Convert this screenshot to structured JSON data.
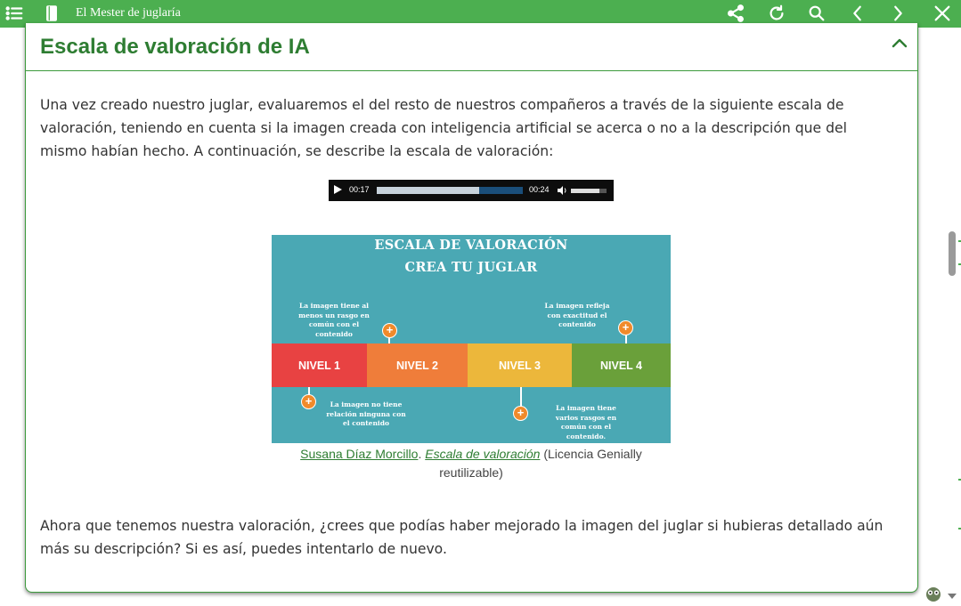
{
  "app": {
    "title": "El Mester de juglaría"
  },
  "toolbar": {
    "icons": [
      "menu-icon",
      "book-icon",
      "share-icon",
      "refresh-icon",
      "search-icon",
      "chevron-left-icon",
      "chevron-right-icon",
      "close-icon"
    ]
  },
  "section": {
    "title": "Escala de valoración de IA",
    "intro": "Una vez creado nuestro juglar, evaluaremos el del resto de nuestros compañeros a través de la siguiente escala de valoración, teniendo en cuenta si la imagen creada con inteligencia artificial se acerca o no a la descripción que del mismo habían hecho.  A continuación, se describe la escala de valoración:",
    "closing": "Ahora que tenemos nuestra valoración, ¿crees que podías haber mejorado la imagen del juglar si hubieras detallado aún más su descripción? Si es así, puedes intentarlo de nuevo."
  },
  "audio": {
    "current_time": "00:17",
    "duration": "00:24",
    "progress": 0.7,
    "volume": 0.8
  },
  "infographic": {
    "title_line1": "ESCALA DE VALORACIÓN",
    "title_line2": "CREA TU JUGLAR",
    "levels": [
      {
        "label": "NIVEL 1",
        "color": "#e84242"
      },
      {
        "label": "NIVEL 2",
        "color": "#ef7d3a"
      },
      {
        "label": "NIVEL 3",
        "color": "#ecb73b"
      },
      {
        "label": "NIVEL 4",
        "color": "#6aa03a"
      }
    ],
    "notes": {
      "n1": "La imagen no tiene relación ninguna con el contenido",
      "n2": "La imagen tiene al menos un rasgo en común con el contenido",
      "n3": "La imagen tiene varios rasgos en común con el contenido.",
      "n4": "La imagen refleja con exactitud el contenido"
    },
    "background": "#4aa8b4"
  },
  "caption": {
    "author": "Susana Díaz Morcillo",
    "sep": ".",
    "work": "Escala de valoración",
    "license": "(Licencia Genially reutilizable)"
  },
  "colors": {
    "brand_green": "#4caf50",
    "title_green": "#2e7d32"
  }
}
